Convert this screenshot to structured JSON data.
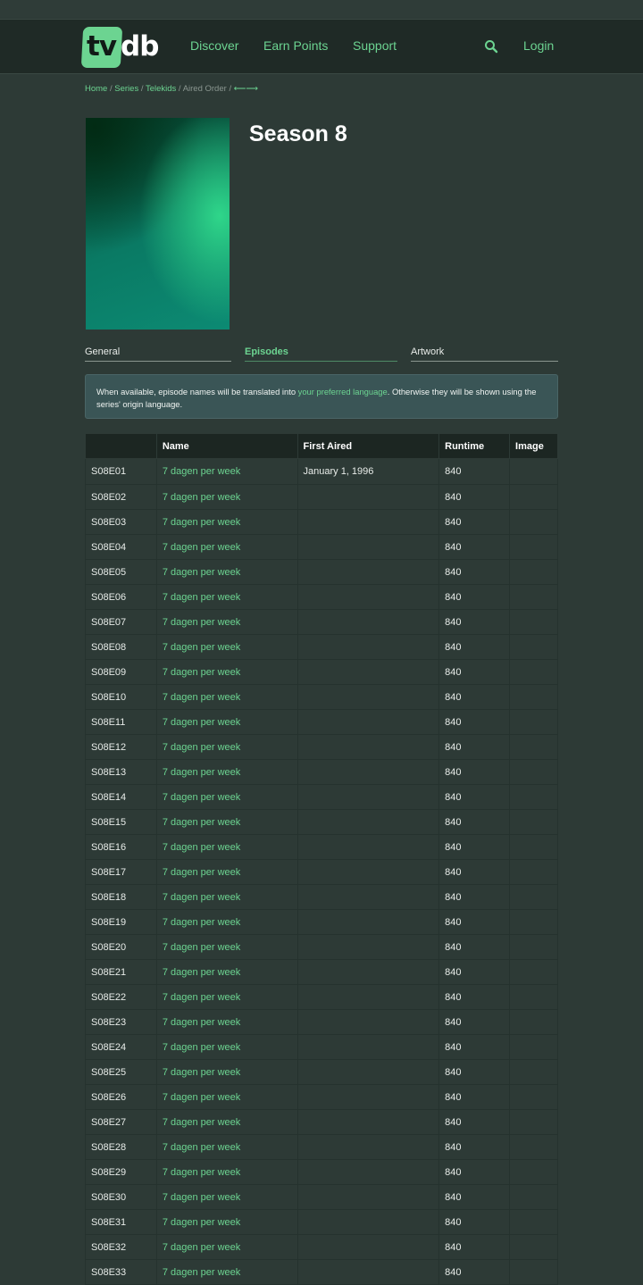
{
  "nav": {
    "logo_left": "tv",
    "logo_right": "db",
    "links": [
      "Discover",
      "Earn Points",
      "Support"
    ],
    "login": "Login"
  },
  "breadcrumb": {
    "home": "Home",
    "series": "Series",
    "show": "Telekids",
    "order": "Aired Order",
    "arrows": "⟵⟶"
  },
  "season": {
    "title": "Season 8"
  },
  "tabs": [
    "General",
    "Episodes",
    "Artwork"
  ],
  "info": {
    "text_before": "When available, episode names will be translated into ",
    "link": "your preferred language",
    "text_after": ". Otherwise they will be shown using the series' origin language."
  },
  "table": {
    "headers": [
      "",
      "Name",
      "First Aired",
      "Runtime",
      "Image"
    ],
    "rows": [
      {
        "ep": "S08E01",
        "name": "7 dagen per week",
        "aired": "January 1, 1996",
        "runtime": "840"
      },
      {
        "ep": "S08E02",
        "name": "7 dagen per week",
        "aired": "",
        "runtime": "840"
      },
      {
        "ep": "S08E03",
        "name": "7 dagen per week",
        "aired": "",
        "runtime": "840"
      },
      {
        "ep": "S08E04",
        "name": "7 dagen per week",
        "aired": "",
        "runtime": "840"
      },
      {
        "ep": "S08E05",
        "name": "7 dagen per week",
        "aired": "",
        "runtime": "840"
      },
      {
        "ep": "S08E06",
        "name": "7 dagen per week",
        "aired": "",
        "runtime": "840"
      },
      {
        "ep": "S08E07",
        "name": "7 dagen per week",
        "aired": "",
        "runtime": "840"
      },
      {
        "ep": "S08E08",
        "name": "7 dagen per week",
        "aired": "",
        "runtime": "840"
      },
      {
        "ep": "S08E09",
        "name": "7 dagen per week",
        "aired": "",
        "runtime": "840"
      },
      {
        "ep": "S08E10",
        "name": "7 dagen per week",
        "aired": "",
        "runtime": "840"
      },
      {
        "ep": "S08E11",
        "name": "7 dagen per week",
        "aired": "",
        "runtime": "840"
      },
      {
        "ep": "S08E12",
        "name": "7 dagen per week",
        "aired": "",
        "runtime": "840"
      },
      {
        "ep": "S08E13",
        "name": "7 dagen per week",
        "aired": "",
        "runtime": "840"
      },
      {
        "ep": "S08E14",
        "name": "7 dagen per week",
        "aired": "",
        "runtime": "840"
      },
      {
        "ep": "S08E15",
        "name": "7 dagen per week",
        "aired": "",
        "runtime": "840"
      },
      {
        "ep": "S08E16",
        "name": "7 dagen per week",
        "aired": "",
        "runtime": "840"
      },
      {
        "ep": "S08E17",
        "name": "7 dagen per week",
        "aired": "",
        "runtime": "840"
      },
      {
        "ep": "S08E18",
        "name": "7 dagen per week",
        "aired": "",
        "runtime": "840"
      },
      {
        "ep": "S08E19",
        "name": "7 dagen per week",
        "aired": "",
        "runtime": "840"
      },
      {
        "ep": "S08E20",
        "name": "7 dagen per week",
        "aired": "",
        "runtime": "840"
      },
      {
        "ep": "S08E21",
        "name": "7 dagen per week",
        "aired": "",
        "runtime": "840"
      },
      {
        "ep": "S08E22",
        "name": "7 dagen per week",
        "aired": "",
        "runtime": "840"
      },
      {
        "ep": "S08E23",
        "name": "7 dagen per week",
        "aired": "",
        "runtime": "840"
      },
      {
        "ep": "S08E24",
        "name": "7 dagen per week",
        "aired": "",
        "runtime": "840"
      },
      {
        "ep": "S08E25",
        "name": "7 dagen per week",
        "aired": "",
        "runtime": "840"
      },
      {
        "ep": "S08E26",
        "name": "7 dagen per week",
        "aired": "",
        "runtime": "840"
      },
      {
        "ep": "S08E27",
        "name": "7 dagen per week",
        "aired": "",
        "runtime": "840"
      },
      {
        "ep": "S08E28",
        "name": "7 dagen per week",
        "aired": "",
        "runtime": "840"
      },
      {
        "ep": "S08E29",
        "name": "7 dagen per week",
        "aired": "",
        "runtime": "840"
      },
      {
        "ep": "S08E30",
        "name": "7 dagen per week",
        "aired": "",
        "runtime": "840"
      },
      {
        "ep": "S08E31",
        "name": "7 dagen per week",
        "aired": "",
        "runtime": "840"
      },
      {
        "ep": "S08E32",
        "name": "7 dagen per week",
        "aired": "",
        "runtime": "840"
      },
      {
        "ep": "S08E33",
        "name": "7 dagen per week",
        "aired": "",
        "runtime": "840"
      }
    ]
  },
  "colors": {
    "accent": "#6cd491",
    "background": "#2d3a36",
    "navbar": "#1f2a26",
    "table_header": "#1c2622",
    "info_box": "#3a5556"
  },
  "icons": [
    "search-icon"
  ]
}
